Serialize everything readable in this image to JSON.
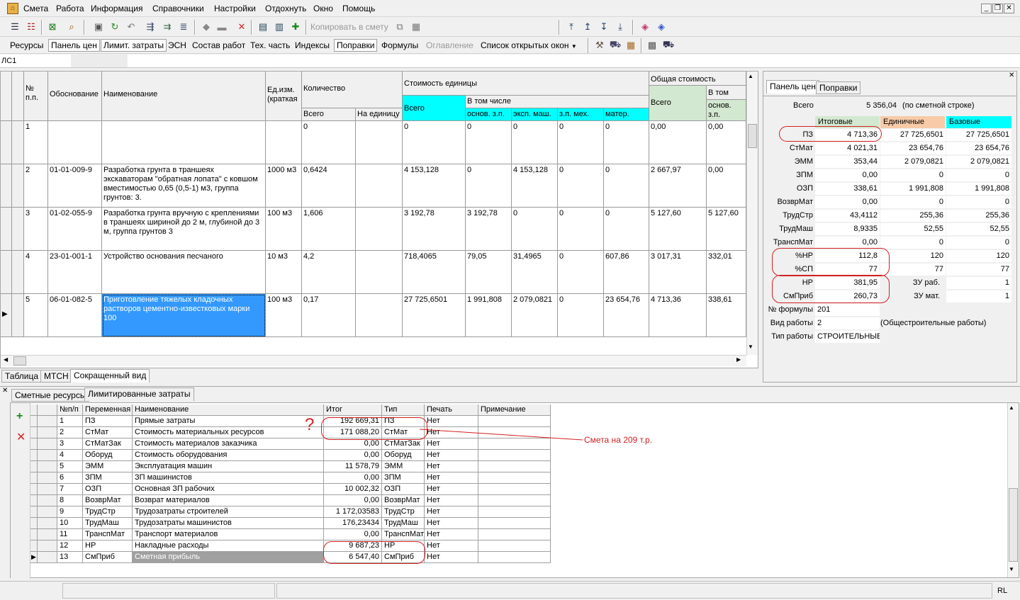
{
  "menu": {
    "items": [
      "Смета",
      "Работа",
      "Информация",
      "Справочники",
      "Настройки",
      "Отдохнуть",
      "Окно",
      "Помощь"
    ]
  },
  "toolbar1": {
    "copy_label": "Копировать в смету"
  },
  "toolbar2": {
    "items": [
      "Ресурсы",
      "Панель цен",
      "Лимит. затраты",
      "ЭСН",
      "Состав работ",
      "Тех. часть",
      "Индексы",
      "Поправки",
      "Формулы",
      "Оглавление",
      "Список открытых окон"
    ]
  },
  "doc_tab": "ЛС1",
  "grid": {
    "headers": {
      "num": "№\nп.п.",
      "basis": "Обоснование",
      "name": "Наименование",
      "unit": "Ед.изм.\n(краткая",
      "qty": "Количество",
      "qty_total": "Всего",
      "qty_unit": "На единицу",
      "cost_unit": "Стоимость единицы",
      "cost_total": "Всего",
      "incl": "В том числе",
      "osn": "основ. з.п.",
      "eksp": "эксп. маш.",
      "zpmeh": "з.п. мех.",
      "mater": "матер.",
      "total_cost": "Общая стоимость",
      "tc_total": "Всего",
      "tc_incl": "В том чис.",
      "tc_osn": "основ.\nз.п."
    },
    "rows": [
      {
        "num": "1",
        "basis": "",
        "name": "",
        "unit": "",
        "qty": "0",
        "qty_unit": "",
        "cost": "0",
        "osn": "0",
        "eksp": "0",
        "zpmeh": "0",
        "mater": "0",
        "tc": "0,00",
        "tc_osn": "0,00"
      },
      {
        "num": "2",
        "basis": "01-01-009-9",
        "name": "Разработка грунта в траншеях экскаваторам \"обратная лопата\" с ковшом вместимостью 0,65 (0,5-1) м3, группа грунтов: 3.",
        "unit": "1000 м3",
        "qty": "0,6424",
        "qty_unit": "",
        "cost": "4 153,128",
        "osn": "0",
        "eksp": "4 153,128",
        "zpmeh": "0",
        "mater": "0",
        "tc": "2 667,97",
        "tc_osn": "0,00"
      },
      {
        "num": "3",
        "basis": "01-02-055-9",
        "name": "Разработка грунта вручную с креплениями в траншеях шириной до 2 м, глубиной до 3 м, группа грунтов 3",
        "unit": "100 м3",
        "qty": "1,606",
        "qty_unit": "",
        "cost": "3 192,78",
        "osn": "3 192,78",
        "eksp": "0",
        "zpmeh": "0",
        "mater": "0",
        "tc": "5 127,60",
        "tc_osn": "5 127,60"
      },
      {
        "num": "4",
        "basis": "23-01-001-1",
        "name": "Устройство основания песчаного",
        "unit": "10 м3",
        "qty": "4,2",
        "qty_unit": "",
        "cost": "718,4065",
        "osn": "79,05",
        "eksp": "31,4965",
        "zpmeh": "0",
        "mater": "607,86",
        "tc": "3 017,31",
        "tc_osn": "332,01"
      },
      {
        "num": "5",
        "basis": "06-01-082-5",
        "name": "Приготовление тяжелых кладочных растворов цементно-известковых марки 100",
        "unit": "100 м3",
        "qty": "0,17",
        "qty_unit": "",
        "cost": "27 725,6501",
        "osn": "1 991,808",
        "eksp": "2 079,0821",
        "zpmeh": "0",
        "mater": "23 654,76",
        "tc": "4 713,36",
        "tc_osn": "338,61"
      }
    ]
  },
  "view_tabs": [
    "Таблица",
    "МТСН",
    "Сокращенный вид"
  ],
  "right_panel": {
    "tabs": [
      "Панель цен",
      "Поправки"
    ],
    "total_label": "Всего",
    "total_value": "5 356,04",
    "total_note": "(по сметной строке)",
    "col_heads": [
      "Итоговые",
      "Единичные",
      "Базовые"
    ],
    "rows": [
      {
        "label": "ПЗ",
        "v1": "4 713,36",
        "v2": "27 725,6501",
        "v3": "27 725,6501"
      },
      {
        "label": "СтМат",
        "v1": "4 021,31",
        "v2": "23 654,76",
        "v3": "23 654,76"
      },
      {
        "label": "ЭММ",
        "v1": "353,44",
        "v2": "2 079,0821",
        "v3": "2 079,0821"
      },
      {
        "label": "ЗПМ",
        "v1": "0,00",
        "v2": "0",
        "v3": "0"
      },
      {
        "label": "ОЗП",
        "v1": "338,61",
        "v2": "1 991,808",
        "v3": "1 991,808"
      },
      {
        "label": "ВозврМат",
        "v1": "0,00",
        "v2": "0",
        "v3": "0"
      },
      {
        "label": "ТрудСтр",
        "v1": "43,4112",
        "v2": "255,36",
        "v3": "255,36"
      },
      {
        "label": "ТрудМаш",
        "v1": "8,9335",
        "v2": "52,55",
        "v3": "52,55"
      },
      {
        "label": "ТранспМат",
        "v1": "0,00",
        "v2": "0",
        "v3": "0"
      },
      {
        "label": "%НР",
        "v1": "112,8",
        "v2": "120",
        "v3": "120"
      },
      {
        "label": "%СП",
        "v1": "77",
        "v2": "77",
        "v3": "77"
      }
    ],
    "nr_label": "НР",
    "nr_value": "381,95",
    "zu_rab_label": "ЗУ раб.",
    "zu_rab_value": "1",
    "sp_label": "СмПриб",
    "sp_value": "260,73",
    "zu_mat_label": "ЗУ мат.",
    "zu_mat_value": "1",
    "formula_label": "№ формулы",
    "formula_value": "201",
    "worktype_label": "Вид работы",
    "worktype_value": "2",
    "worktype_note": "(Общестроительные работы)",
    "worktype2_label": "Тип работы",
    "worktype2_value": "СТРОИТЕЛЬНЫЕ"
  },
  "lower": {
    "tabs": [
      "Сметные ресурсы",
      "Лимитированные затраты"
    ],
    "headers": [
      "№п/п",
      "Переменная",
      "Наименование",
      "Итог",
      "Тип",
      "Печать",
      "Примечание"
    ],
    "rows": [
      {
        "n": "1",
        "var": "ПЗ",
        "name": "Прямые затраты",
        "sum": "192 669,31",
        "type": "ПЗ",
        "print": "Нет"
      },
      {
        "n": "2",
        "var": "СтМат",
        "name": "Стоимость материальных ресурсов",
        "sum": "171 088,20",
        "type": "СтМат",
        "print": "Нет"
      },
      {
        "n": "3",
        "var": "СтМатЗак",
        "name": "Стоимость материалов заказчика",
        "sum": "0,00",
        "type": "СтМатЗак",
        "print": "Нет"
      },
      {
        "n": "4",
        "var": "Оборуд",
        "name": "Стоимость оборудования",
        "sum": "0,00",
        "type": "Оборуд",
        "print": "Нет"
      },
      {
        "n": "5",
        "var": "ЭММ",
        "name": "Эксплуатация машин",
        "sum": "11 578,79",
        "type": "ЭММ",
        "print": "Нет"
      },
      {
        "n": "6",
        "var": "ЗПМ",
        "name": "ЗП машинистов",
        "sum": "0,00",
        "type": "ЗПМ",
        "print": "Нет"
      },
      {
        "n": "7",
        "var": "ОЗП",
        "name": "Основная ЗП рабочих",
        "sum": "10 002,32",
        "type": "ОЗП",
        "print": "Нет"
      },
      {
        "n": "8",
        "var": "ВозврМат",
        "name": "Возврат материалов",
        "sum": "0,00",
        "type": "ВозврМат",
        "print": "Нет"
      },
      {
        "n": "9",
        "var": "ТрудСтр",
        "name": "Трудозатраты строителей",
        "sum": "1 172,03583",
        "type": "ТрудСтр",
        "print": "Нет"
      },
      {
        "n": "10",
        "var": "ТрудМаш",
        "name": "Трудозатраты машинистов",
        "sum": "176,23434",
        "type": "ТрудМаш",
        "print": "Нет"
      },
      {
        "n": "11",
        "var": "ТранспМат",
        "name": "Транспорт материалов",
        "sum": "0,00",
        "type": "ТранспМат",
        "print": "Нет"
      },
      {
        "n": "12",
        "var": "НР",
        "name": "Накладные расходы",
        "sum": "9 687,23",
        "type": "НР",
        "print": "Нет"
      },
      {
        "n": "13",
        "var": "СмПриб",
        "name": "Сметная прибыль",
        "sum": "6 547,40",
        "type": "СмПриб",
        "print": "Нет"
      }
    ]
  },
  "annotation": {
    "question": "?",
    "note": "Смета на 209 т.р."
  },
  "status": {
    "right": "RL"
  }
}
